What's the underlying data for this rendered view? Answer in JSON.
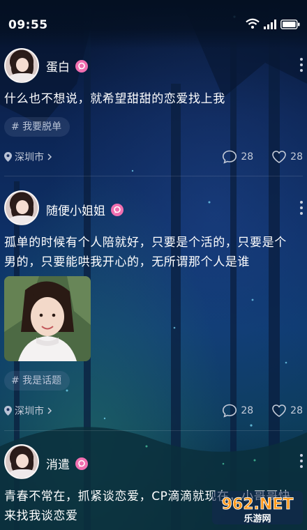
{
  "status_bar": {
    "time": "09:55",
    "icons": [
      "wifi-icon",
      "signal-icon",
      "battery-icon"
    ]
  },
  "posts": [
    {
      "username": "蛋白",
      "content": "什么也不想说，就希望甜甜的恋爱找上我",
      "tag": "# 我要脱单",
      "location": "深圳市",
      "comments": "28",
      "likes": "28"
    },
    {
      "username": "随便小姐姐",
      "content": "孤单的时候有个人陪就好，只要是个活的，只要是个男的，只要能哄我开心的，无所谓那个人是谁",
      "has_image": true,
      "tag": "# 我是话题",
      "location": "深圳市",
      "comments": "28",
      "likes": "28"
    },
    {
      "username": "消遣",
      "content": "青春不常在，抓紧谈恋爱，CP滴滴就现在，小哥哥快来找我谈恋爱"
    }
  ],
  "watermark": {
    "brand": "962.NET",
    "subtitle": "乐游网"
  },
  "colors": {
    "accent_pink": "#f16fb0",
    "meta_text": "#c5ccd9",
    "tag_bg": "rgba(120,140,180,0.18)"
  }
}
